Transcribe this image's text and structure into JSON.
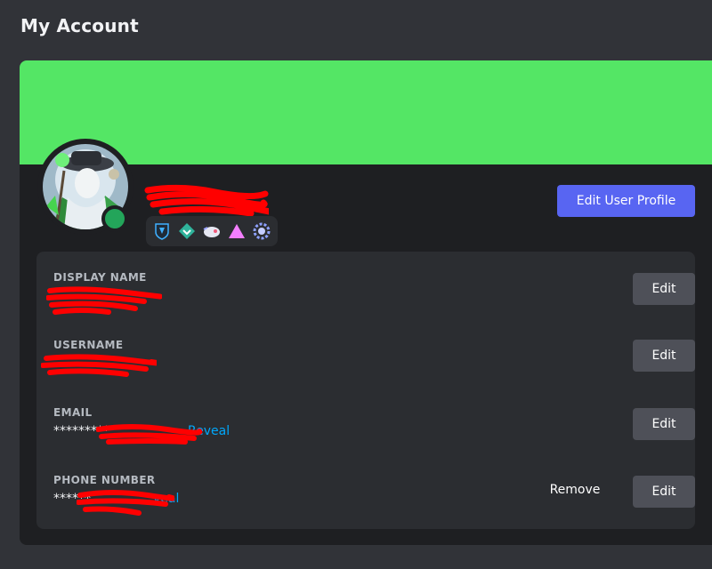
{
  "page": {
    "title": "My Account"
  },
  "profile": {
    "banner_color": "#54e665",
    "status": "online",
    "status_color": "#23a55a",
    "edit_profile_label": "Edit User Profile",
    "badges": [
      {
        "icon": "hypesquad-shield-icon"
      },
      {
        "icon": "diamond-badge-icon"
      },
      {
        "icon": "nitro-boost-icon"
      },
      {
        "icon": "triangle-badge-icon"
      },
      {
        "icon": "gear-badge-icon"
      }
    ]
  },
  "fields": {
    "display_name": {
      "label": "DISPLAY NAME",
      "edit_label": "Edit"
    },
    "username": {
      "label": "USERNAME",
      "edit_label": "Edit"
    },
    "email": {
      "label": "EMAIL",
      "value_masked": "*********",
      "reveal_label": "Reveal",
      "edit_label": "Edit"
    },
    "phone": {
      "label": "PHONE NUMBER",
      "value_masked": "******",
      "reveal_label": "veal",
      "remove_label": "Remove",
      "edit_label": "Edit"
    }
  },
  "colors": {
    "accent": "#5865f2",
    "link": "#00a8fc",
    "redaction": "#ff0000"
  }
}
